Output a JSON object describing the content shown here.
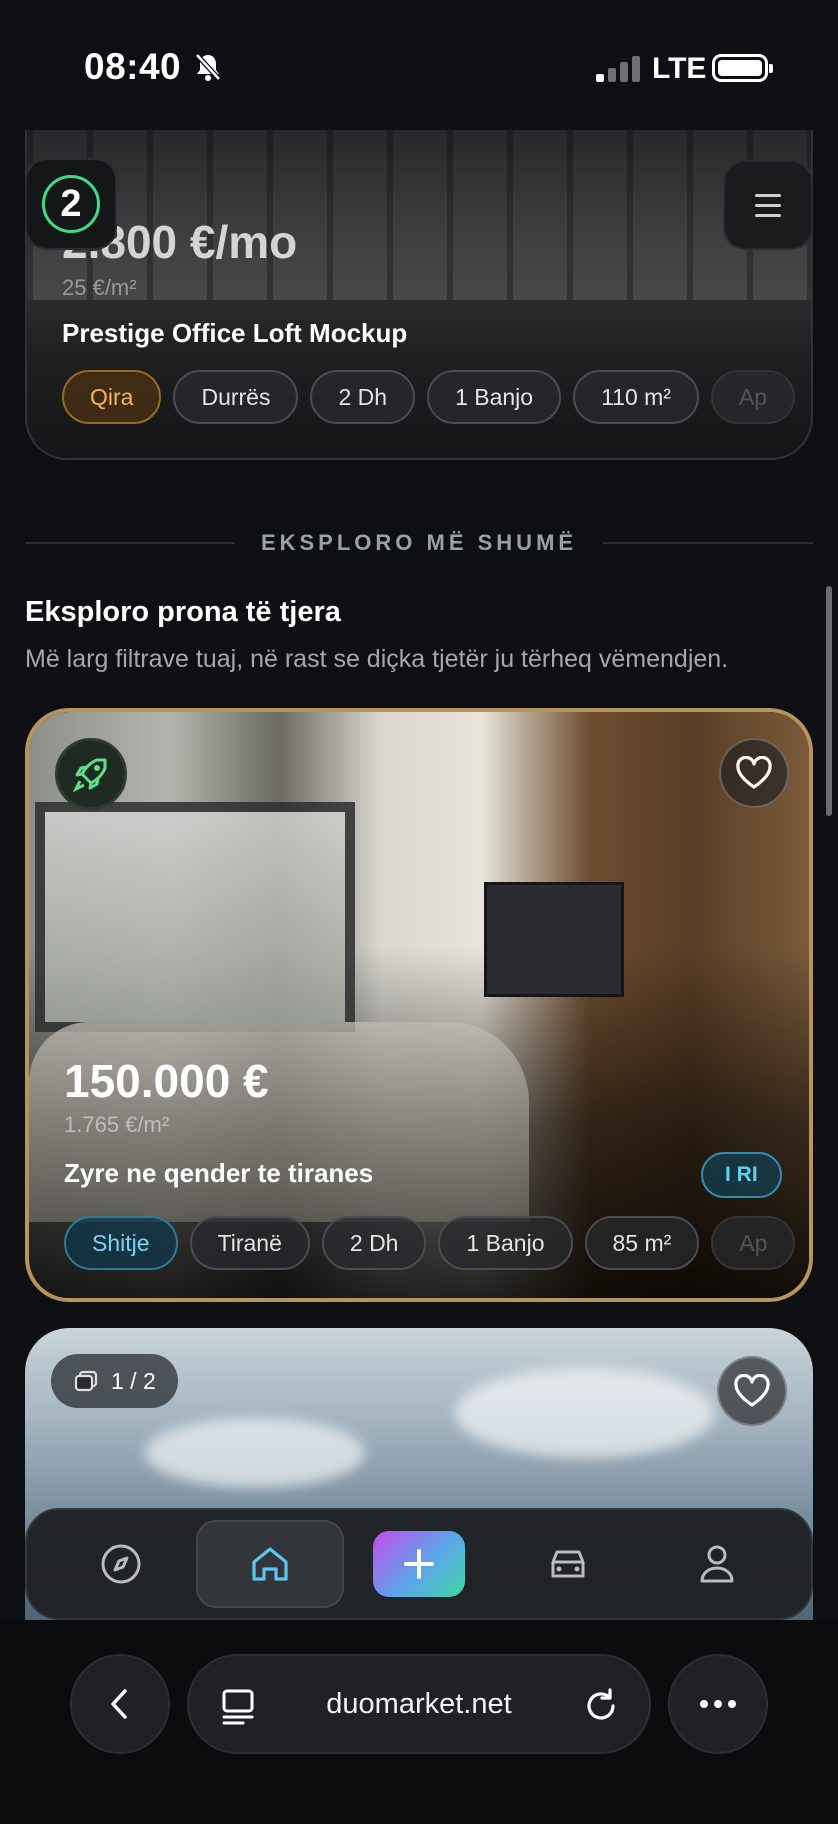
{
  "status_bar": {
    "time": "08:40",
    "network": "LTE"
  },
  "top_listing": {
    "price": "2.800 €/mo",
    "price_per_m2": "25 €/m²",
    "title": "Prestige Office Loft Mockup",
    "chips": [
      "Qira",
      "Durrës",
      "2 Dh",
      "1 Banjo",
      "110 m²",
      "Ap"
    ]
  },
  "divider_label": "EKSPLORO MË SHUMË",
  "section": {
    "title": "Eksploro prona të tjera",
    "subtitle": "Më larg filtrave tuaj, në rast se diçka tjetër ju tërheq vëmendjen."
  },
  "featured_listing": {
    "price": "150.000 €",
    "price_per_m2": "1.765 €/m²",
    "title": "Zyre ne qender te tiranes",
    "new_badge": "I RI",
    "chips": [
      "Shitje",
      "Tiranë",
      "2 Dh",
      "1 Banjo",
      "85 m²",
      "Ap"
    ]
  },
  "second_listing": {
    "photo_counter": "1 / 2"
  },
  "bottom_nav": {
    "items": [
      "compass-icon",
      "home-icon",
      "plus-icon",
      "car-icon",
      "user-icon"
    ],
    "active": "home"
  },
  "browser": {
    "url": "duomarket.net"
  },
  "colors": {
    "rent": "#f3b55a",
    "sale": "#7cd3f2",
    "gold_border": "#b8945a",
    "logo_ring": "#3ddc84"
  }
}
